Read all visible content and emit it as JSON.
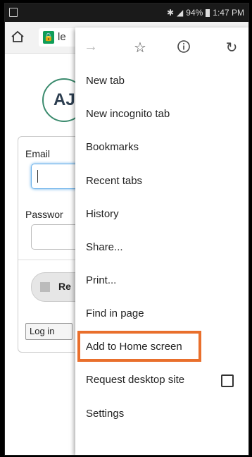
{
  "status_bar": {
    "battery_percent": "94%",
    "time": "1:47 PM"
  },
  "toolbar": {
    "url_partial": "le"
  },
  "page": {
    "logo_text": "AJ",
    "email_label": "Email",
    "password_label": "Passwor",
    "remember_label": "Re",
    "login_button": "Log in"
  },
  "menu": {
    "top_icons": [
      "forward-icon",
      "star-icon",
      "info-icon",
      "reload-icon"
    ],
    "items": [
      "New tab",
      "New incognito tab",
      "Bookmarks",
      "Recent tabs",
      "History",
      "Share...",
      "Print...",
      "Find in page",
      "Add to Home screen",
      "Request desktop site",
      "Settings"
    ],
    "highlight_color": "#e96f2c"
  }
}
